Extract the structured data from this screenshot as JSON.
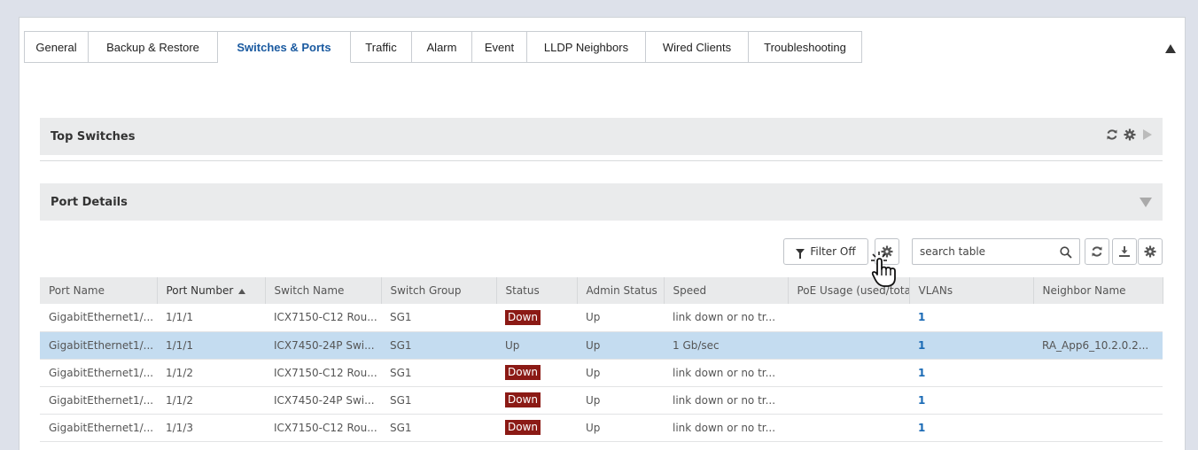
{
  "tabs": [
    {
      "label": "General"
    },
    {
      "label": "Backup & Restore"
    },
    {
      "label": "Switches & Ports",
      "active": true
    },
    {
      "label": "Traffic"
    },
    {
      "label": "Alarm"
    },
    {
      "label": "Event"
    },
    {
      "label": "LLDP Neighbors"
    },
    {
      "label": "Wired Clients"
    },
    {
      "label": "Troubleshooting"
    }
  ],
  "sections": {
    "top_switches": "Top Switches",
    "port_details": "Port Details"
  },
  "toolbar": {
    "filter_label": "Filter Off",
    "search_placeholder": "search table"
  },
  "icons": {
    "refresh": "refresh-icon",
    "settings": "gear-icon",
    "expand": "play-icon",
    "collapse": "triangle-down-icon",
    "filter": "funnel-icon",
    "search": "search-icon",
    "download": "download-icon",
    "pointer": "hand-cursor-icon"
  },
  "table": {
    "columns": [
      "Port Name",
      "Port Number",
      "Switch Name",
      "Switch Group",
      "Status",
      "Admin Status",
      "Speed",
      "PoE Usage (used/tota",
      "VLANs",
      "Neighbor Name"
    ],
    "sorted_column": "Port Number",
    "rows": [
      {
        "port_name": "GigabitEthernet1/...",
        "port_number": "1/1/1",
        "switch_name": "ICX7150-C12 Rou...",
        "switch_group": "SG1",
        "status": "Down",
        "admin_status": "Up",
        "speed": "link down or no tr...",
        "poe": "",
        "vlans": "1",
        "neighbor": ""
      },
      {
        "port_name": "GigabitEthernet1/...",
        "port_number": "1/1/1",
        "switch_name": "ICX7450-24P Swi...",
        "switch_group": "SG1",
        "status": "Up",
        "admin_status": "Up",
        "speed": "1 Gb/sec",
        "poe": "",
        "vlans": "1",
        "neighbor": "RA_App6_10.2.0.2...",
        "selected": true
      },
      {
        "port_name": "GigabitEthernet1/...",
        "port_number": "1/1/2",
        "switch_name": "ICX7150-C12 Rou...",
        "switch_group": "SG1",
        "status": "Down",
        "admin_status": "Up",
        "speed": "link down or no tr...",
        "poe": "",
        "vlans": "1",
        "neighbor": ""
      },
      {
        "port_name": "GigabitEthernet1/...",
        "port_number": "1/1/2",
        "switch_name": "ICX7450-24P Swi...",
        "switch_group": "SG1",
        "status": "Down",
        "admin_status": "Up",
        "speed": "link down or no tr...",
        "poe": "",
        "vlans": "1",
        "neighbor": ""
      },
      {
        "port_name": "GigabitEthernet1/...",
        "port_number": "1/1/3",
        "switch_name": "ICX7150-C12 Rou...",
        "switch_group": "SG1",
        "status": "Down",
        "admin_status": "Up",
        "speed": "link down or no tr...",
        "poe": "",
        "vlans": "1",
        "neighbor": ""
      }
    ]
  },
  "colors": {
    "status_down_bg": "#8b1a15",
    "selected_row_bg": "#c4dcf0",
    "active_tab_text": "#1a5aa0",
    "vlan_link": "#1a6ab5"
  }
}
